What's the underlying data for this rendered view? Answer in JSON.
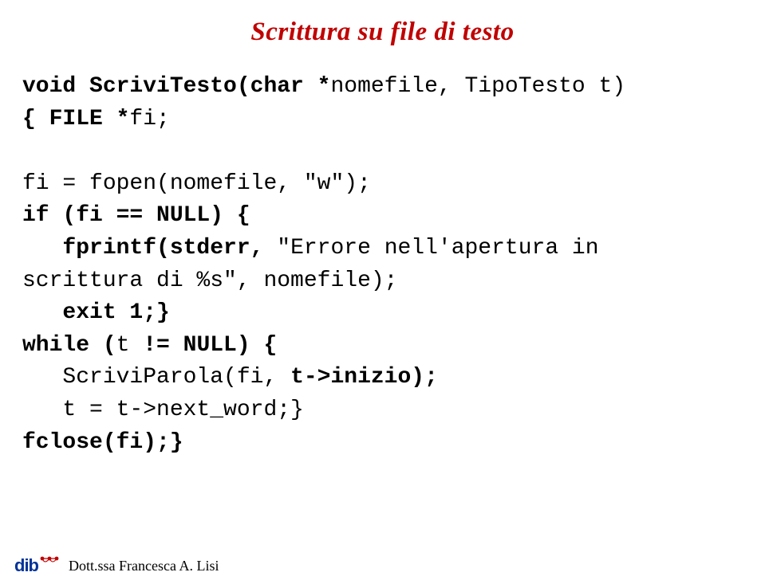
{
  "title": "Scrittura su file di testo",
  "code": {
    "l1a": "void ScriviTesto(char *",
    "l1b": "nomefile, TipoTesto t)",
    "l2a": "{ FILE *",
    "l2b": "fi;",
    "l3": "",
    "l4a": "fi = fopen(nomefile, \"w\");",
    "l5a": "if (fi == NULL) {",
    "l6a": "   fprintf(stderr, ",
    "l6b": "\"Errore nell'apertura in",
    "l7": "scrittura di %s\", nomefile);",
    "l8a": "   exit 1;}",
    "l9a": "while (",
    "l9b": "t ",
    "l9c": "!= NULL) {",
    "l10a": "   ScriviParola(fi, ",
    "l10b": "t->inizio);",
    "l11a": "   t = t->next_word;}",
    "l12a": "fclose(fi);}"
  },
  "footer": {
    "author": "Dott.ssa Francesca A. Lisi"
  }
}
